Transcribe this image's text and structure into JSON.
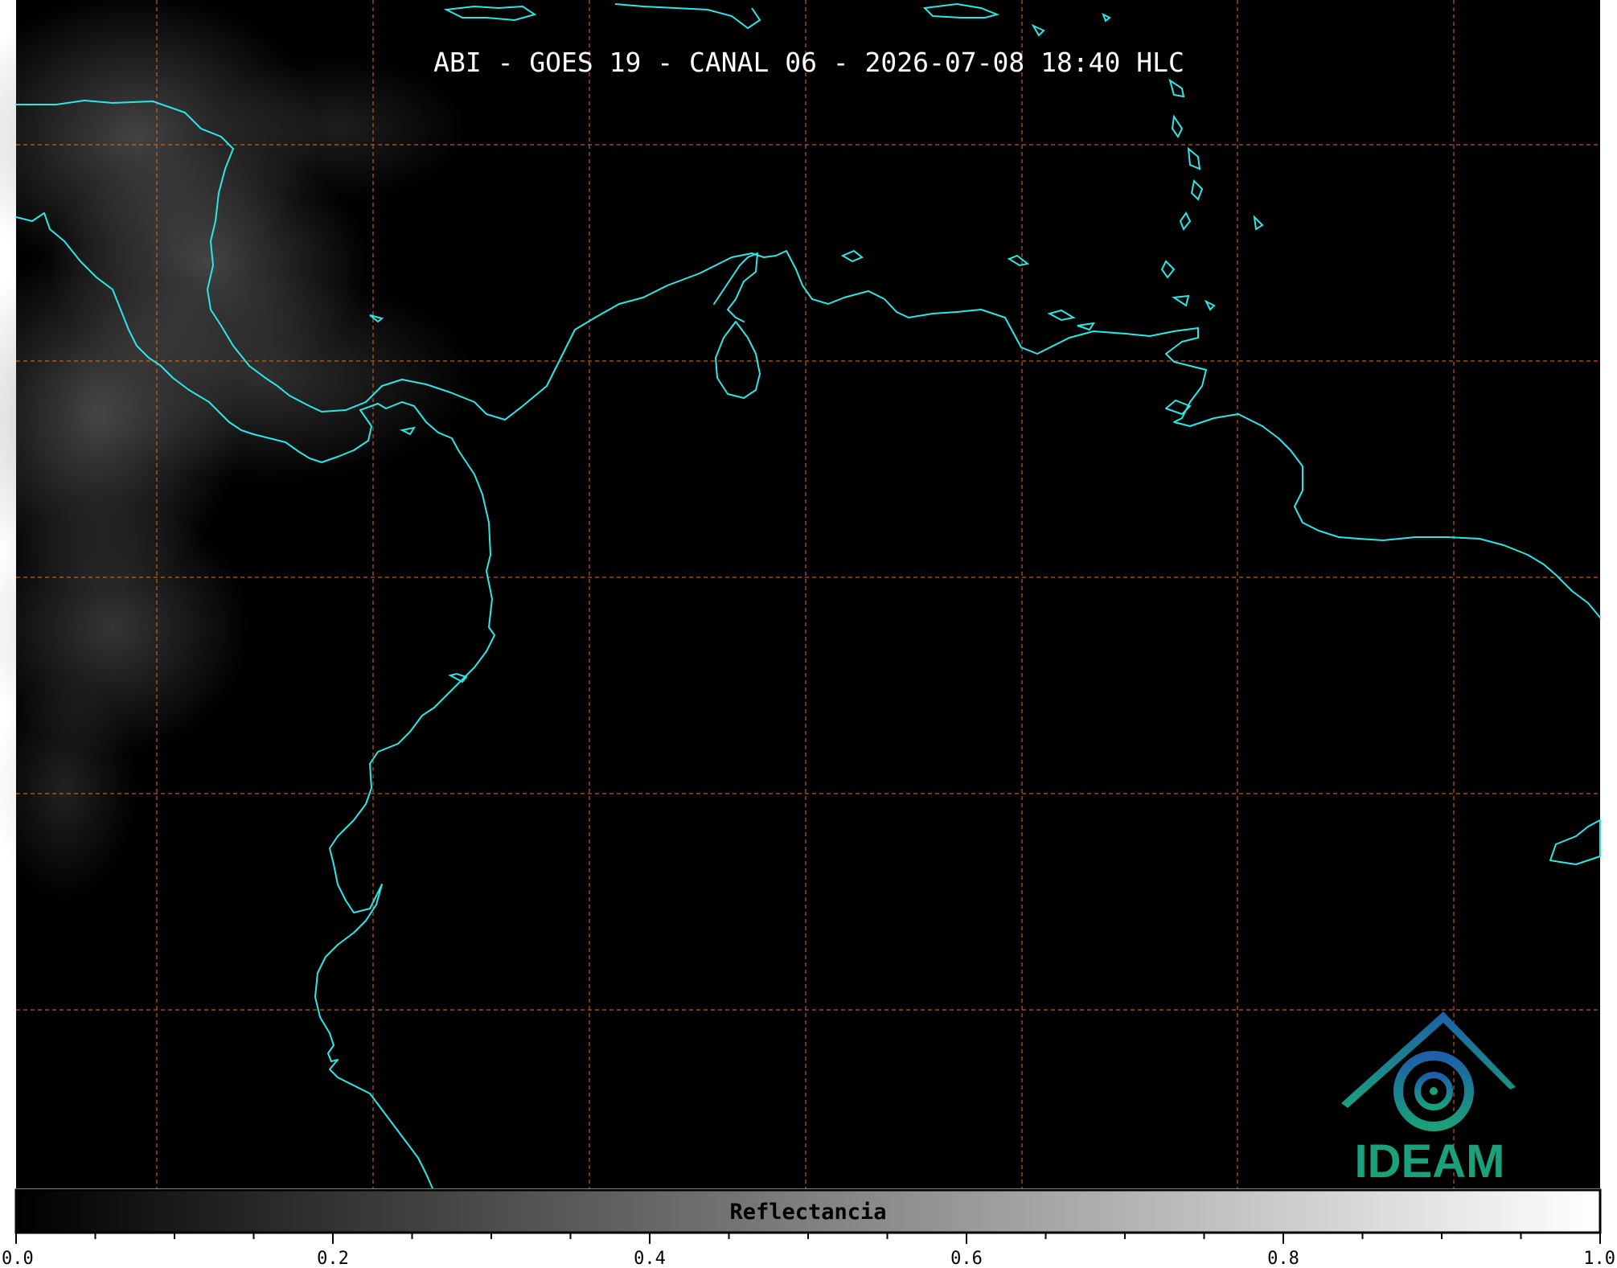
{
  "title": "ABI - GOES 19 - CANAL 06 - 2026-07-08 18:40 HLC",
  "colorbar": {
    "label": "Reflectancia",
    "ticks": [
      "0.0",
      "0.2",
      "0.4",
      "0.6",
      "0.8",
      "1.0"
    ],
    "range": [
      0.0,
      1.0
    ],
    "minor_step": 0.05,
    "colormap": [
      "#000000",
      "#ffffff"
    ]
  },
  "logo": {
    "text": "IDEAM",
    "text_color": "#1aa07a",
    "mark_color": "#1e6fa8"
  },
  "map": {
    "background": "#000000",
    "coastline_color": "#2ee6e6",
    "grid_color": "#d2691e",
    "grid_style": "dashed"
  }
}
